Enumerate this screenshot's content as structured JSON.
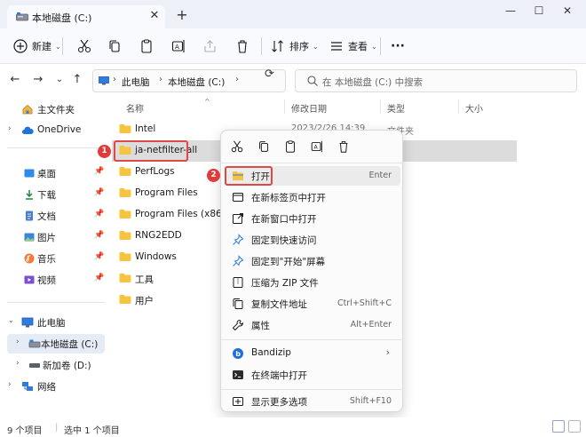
{
  "window": {
    "tab_title": "本地磁盘 (C:)",
    "new_tab": "+",
    "close_tab": "✕",
    "controls": {
      "minimize": "—",
      "maximize": "☐",
      "close": "✕"
    }
  },
  "toolbar": {
    "new_label": "新建",
    "sort_label": "排序",
    "view_label": "查看",
    "more": "···"
  },
  "address": {
    "crumbs": [
      "此电脑",
      "本地磁盘 (C:)"
    ],
    "search_placeholder": "在 本地磁盘 (C:) 中搜索"
  },
  "sidebar": {
    "home": "主文件夹",
    "onedrive": "OneDrive",
    "quick": [
      "桌面",
      "下载",
      "文档",
      "图片",
      "音乐",
      "视频"
    ],
    "this_pc": "此电脑",
    "drive_c": "本地磁盘 (C:)",
    "drive_d": "新加卷 (D:)",
    "network": "网络"
  },
  "columns": {
    "name": "名称",
    "modified": "修改日期",
    "type": "类型",
    "size": "大小"
  },
  "files": [
    {
      "name": "Intel",
      "date": "2023/2/26 14:39",
      "type": "文件夹"
    },
    {
      "name": "ja-netfilter-all",
      "date": "",
      "type": "夹"
    },
    {
      "name": "PerfLogs",
      "date": "",
      "type": "夹"
    },
    {
      "name": "Program Files",
      "date": "",
      "type": "夹"
    },
    {
      "name": "Program Files (x86)",
      "date": "",
      "type": "夹"
    },
    {
      "name": "RNG2EDD",
      "date": "",
      "type": "夹"
    },
    {
      "name": "Windows",
      "date": "",
      "type": "夹"
    },
    {
      "name": "工具",
      "date": "",
      "type": "夹"
    },
    {
      "name": "用户",
      "date": "",
      "type": "夹"
    }
  ],
  "badges": {
    "step1": "1",
    "step2": "2"
  },
  "context_menu": {
    "items": [
      {
        "label": "打开",
        "shortcut": "Enter"
      },
      {
        "label": "在新标签页中打开",
        "shortcut": ""
      },
      {
        "label": "在新窗口中打开",
        "shortcut": ""
      },
      {
        "label": "固定到快速访问",
        "shortcut": ""
      },
      {
        "label": "固定到\"开始\"屏幕",
        "shortcut": ""
      },
      {
        "label": "压缩为 ZIP 文件",
        "shortcut": ""
      },
      {
        "label": "复制文件地址",
        "shortcut": "Ctrl+Shift+C"
      },
      {
        "label": "属性",
        "shortcut": "Alt+Enter"
      },
      {
        "label": "Bandizip",
        "shortcut": ""
      },
      {
        "label": "在终端中打开",
        "shortcut": ""
      },
      {
        "label": "显示更多选项",
        "shortcut": "Shift+F10"
      }
    ]
  },
  "status": {
    "count": "9 个项目",
    "selected": "选中 1 个项目"
  },
  "colors": {
    "accent": "#0067c0",
    "folder": "#f5c542",
    "highlight": "#e04848",
    "selected_row": "#dcdcdc"
  }
}
